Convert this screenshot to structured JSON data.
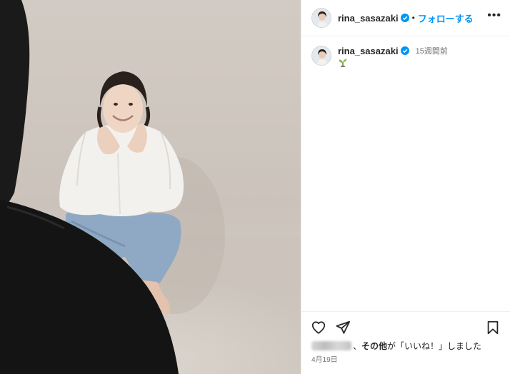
{
  "post": {
    "username": "rina_sasazaki",
    "follow_label": "フォローする",
    "dot": "•",
    "more_label": "•••",
    "verified": true
  },
  "caption": {
    "username": "rina_sasazaki",
    "timestamp": "15週間前",
    "emoji": "🌱"
  },
  "likes": {
    "separator": "、",
    "others_bold": "その他",
    "text": "が「いいね！」しました"
  },
  "date": "4月19日",
  "icons": {
    "like": "heart-icon",
    "share": "send-icon",
    "save": "bookmark-icon",
    "verified": "verified-badge-icon"
  },
  "colors": {
    "accent": "#0095f6",
    "text": "#262626",
    "muted": "#737373",
    "divider": "#efefef",
    "backdrop": "#cfc7c0"
  }
}
